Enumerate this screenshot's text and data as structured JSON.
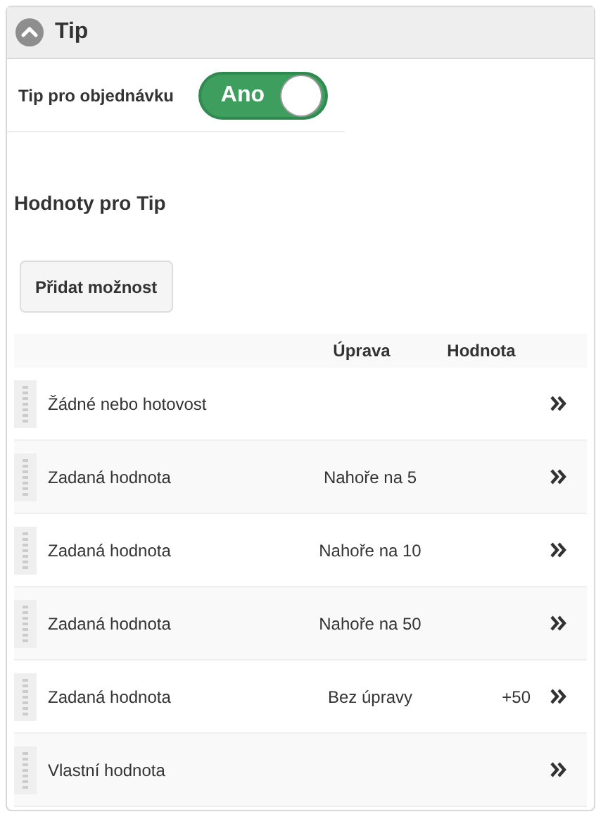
{
  "section": {
    "title": "Tip",
    "expanded": true
  },
  "tip_toggle": {
    "label": "Tip pro objednávku",
    "on": true,
    "value_label": "Ano"
  },
  "values_heading": "Hodnoty pro Tip",
  "add_button": "Přidat možnost",
  "table": {
    "columns": [
      "Úprava",
      "Hodnota"
    ],
    "rows": [
      {
        "name": "Žádné nebo hotovost"
      },
      {
        "name": "Zadaná hodnota",
        "adjustment": "Nahoře na 5"
      },
      {
        "name": "Zadaná hodnota",
        "adjustment": "Nahoře na 10"
      },
      {
        "name": "Zadaná hodnota",
        "adjustment": "Nahoře na 50"
      },
      {
        "name": "Zadaná hodnota",
        "adjustment": "Bez úpravy",
        "value": "+50"
      },
      {
        "name": "Vlastní hodnota"
      }
    ]
  }
}
